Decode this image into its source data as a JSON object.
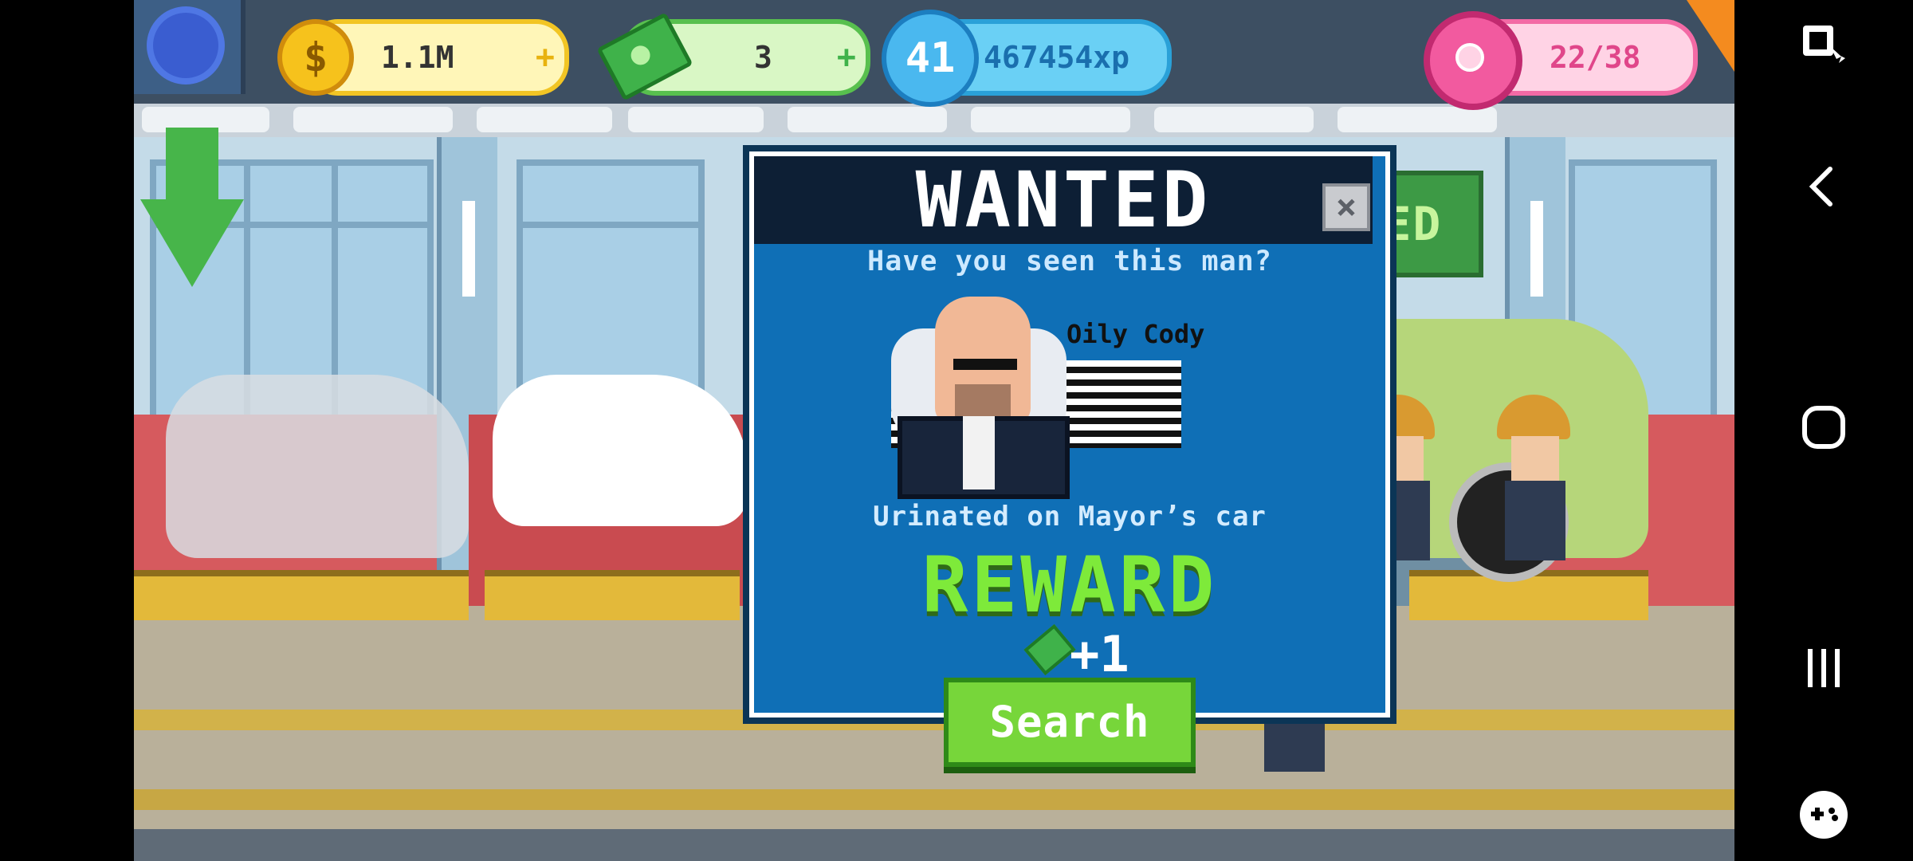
{
  "hud": {
    "coins": "1.1M",
    "coins_plus": "+",
    "cash": "3",
    "cash_plus": "+",
    "level": "41",
    "xp": "467454xp",
    "donuts": "22/38"
  },
  "background": {
    "speed_up_sign": "SPEED UP"
  },
  "modal": {
    "title": "WANTED",
    "close_symbol": "×",
    "question": "Have you seen this man?",
    "wanted_name": "Oily Cody",
    "crime": "Urinated on Mayor’s car",
    "reward_title": "REWARD",
    "reward_amount": "+1",
    "search_button": "Search"
  },
  "system_nav": {
    "icons": [
      "screen-capture-icon",
      "back-icon",
      "home-icon",
      "recents-icon",
      "game-launcher-icon"
    ]
  },
  "colors": {
    "modal_bg": "#0f6fb6",
    "reward_green": "#7eea3a",
    "search_button": "#77d63a"
  }
}
